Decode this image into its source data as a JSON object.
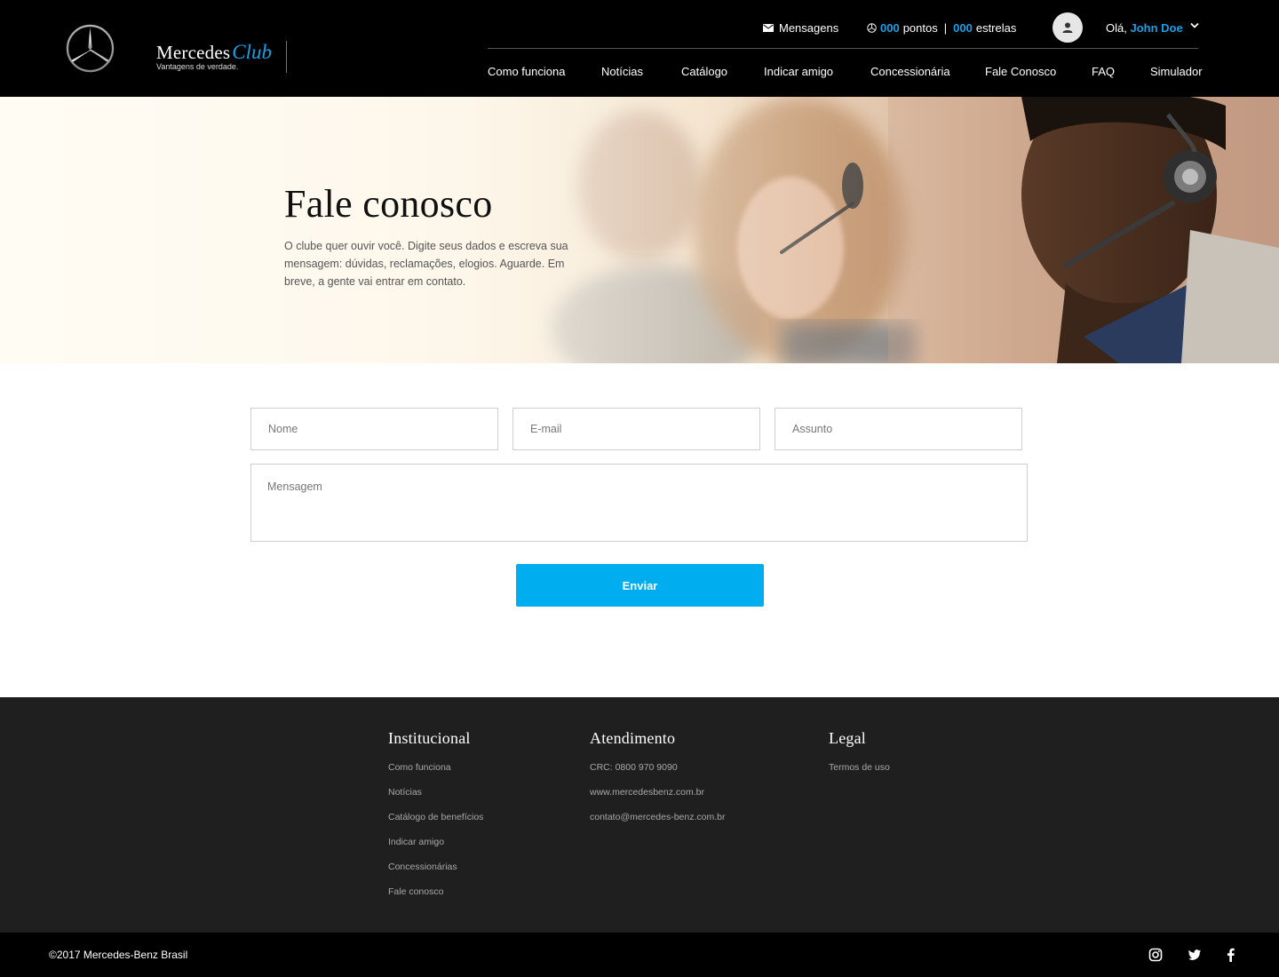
{
  "header": {
    "brand_name": "Mercedes",
    "brand_club": "Club",
    "brand_tagline": "Vantagens de verdade.",
    "messages_label": "Mensagens",
    "points_value": "000",
    "points_label": "pontos",
    "separator": "|",
    "stars_value": "000",
    "stars_label": "estrelas",
    "greeting": "Olá,",
    "user_name": "John Doe",
    "accent_color": "#18a0e8"
  },
  "nav": {
    "items": [
      {
        "label": "Como funciona"
      },
      {
        "label": "Notícias"
      },
      {
        "label": "Catálogo"
      },
      {
        "label": "Indicar amigo"
      },
      {
        "label": "Concessionária"
      },
      {
        "label": "Fale Conosco"
      },
      {
        "label": "FAQ"
      },
      {
        "label": "Simulador"
      }
    ]
  },
  "hero": {
    "title": "Fale conosco",
    "text": "O clube quer ouvir você. Digite seus dados e escreva sua mensagem: dúvidas, reclamações, elogios. Aguarde. Em breve, a gente vai entrar em contato."
  },
  "form": {
    "name_placeholder": "Nome",
    "email_placeholder": "E-mail",
    "subject_placeholder": "Assunto",
    "message_placeholder": "Mensagem",
    "submit_label": "Enviar",
    "button_color": "#00adef"
  },
  "footer": {
    "institucional": {
      "title": "Institucional",
      "links": [
        "Como funciona",
        "Notícias",
        "Catálogo de benefícios",
        "Indicar amigo",
        "Concessionárias",
        "Fale conosco"
      ]
    },
    "atendimento": {
      "title": "Atendimento",
      "items": [
        "CRC: 0800 970 9090",
        "www.mercedesbenz.com.br",
        "contato@mercedes-benz.com.br"
      ]
    },
    "legal": {
      "title": "Legal",
      "links": [
        "Termos de uso"
      ]
    },
    "copyright": "©2017 Mercedes-Benz Brasil",
    "social_icons": [
      "instagram-icon",
      "twitter-icon",
      "facebook-icon"
    ]
  }
}
